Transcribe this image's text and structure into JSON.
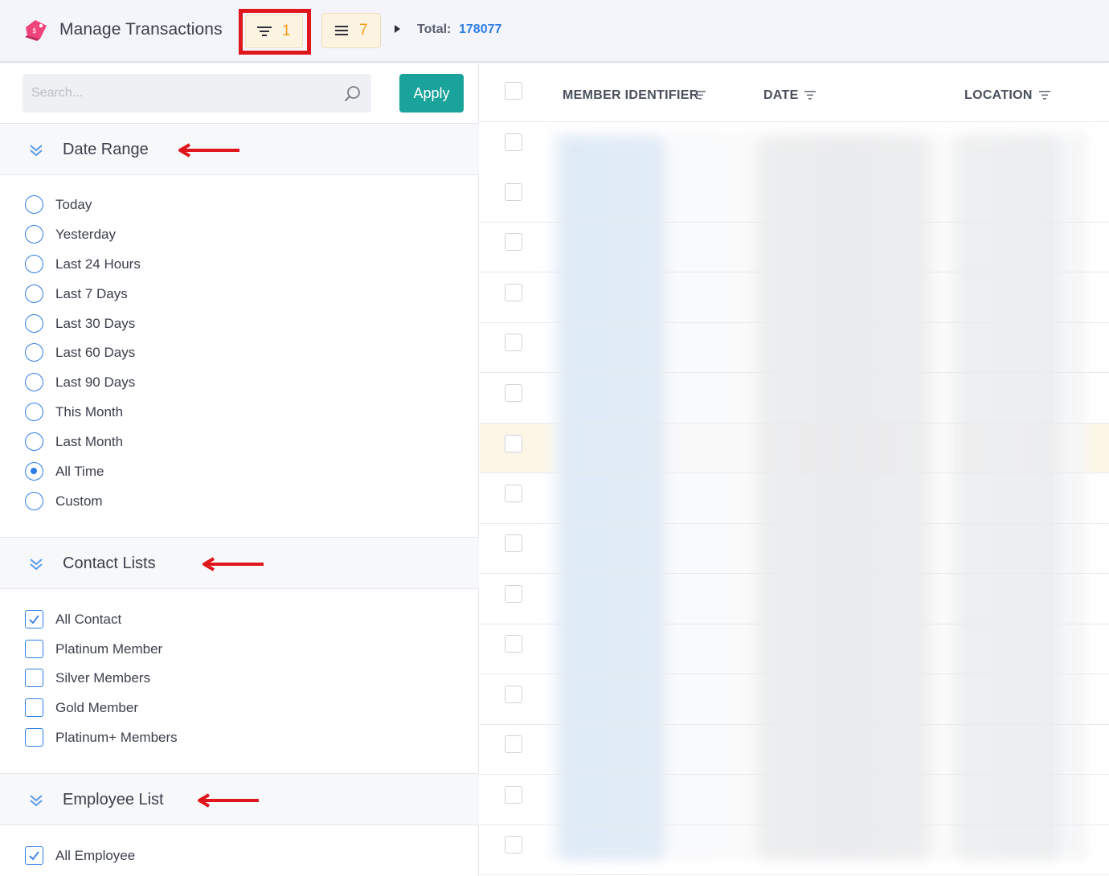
{
  "header": {
    "title": "Manage Transactions",
    "filter_count": "1",
    "columns_count": "7",
    "total_label": "Total:",
    "total_value": "178077"
  },
  "search": {
    "placeholder": "Search..."
  },
  "apply_label": "Apply",
  "colors": {
    "accent": "#2f7ee6",
    "apply": "#1aa39a",
    "chip_bg": "#fdf3e1",
    "chip_count": "#f29a1a",
    "highlight": "#e0161d",
    "logo": "#f0427b"
  },
  "sections": {
    "date_range": {
      "title": "Date Range",
      "options": [
        "Today",
        "Yesterday",
        "Last 24 Hours",
        "Last 7 Days",
        "Last 30 Days",
        "Last 60 Days",
        "Last 90 Days",
        "This Month",
        "Last Month",
        "All Time",
        "Custom"
      ],
      "selected": "All Time"
    },
    "contact_lists": {
      "title": "Contact Lists",
      "options": [
        "All Contact",
        "Platinum Member",
        "Silver Members",
        "Gold Member",
        "Platinum+ Members"
      ],
      "checked": [
        "All Contact"
      ]
    },
    "employee_list": {
      "title": "Employee List",
      "options": [
        "All Employee"
      ],
      "checked": [
        "All Employee"
      ]
    }
  },
  "table": {
    "columns": [
      "MEMBER IDENTIFIER",
      "DATE",
      "LOCATION"
    ]
  },
  "icons": [
    "logo-icon",
    "filter-icon",
    "menu-icon",
    "caret-right-icon",
    "search-icon",
    "chevron-down-icon",
    "sort-icon",
    "arrow-left-icon",
    "check-icon"
  ]
}
